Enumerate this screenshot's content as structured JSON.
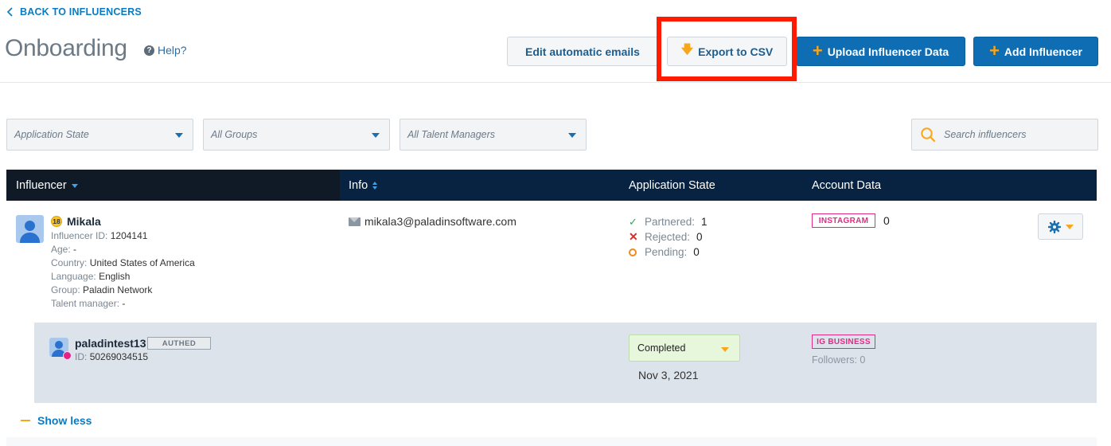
{
  "header": {
    "back_label": "BACK TO INFLUENCERS",
    "title": "Onboarding",
    "help_label": "Help?",
    "buttons": {
      "edit_emails": "Edit automatic emails",
      "export_csv": "Export to CSV",
      "upload_data": "Upload Influencer Data",
      "add_influencer": "Add Influencer"
    }
  },
  "filters": {
    "application_state": "Application State",
    "groups": "All Groups",
    "talent_managers": "All Talent Managers",
    "search_placeholder": "Search influencers"
  },
  "table": {
    "columns": [
      "Influencer",
      "Info",
      "Application State",
      "Account Data"
    ]
  },
  "row": {
    "age_badge": "18",
    "name": "Mikala",
    "details": [
      {
        "label": "Influencer ID:",
        "value": "1204141"
      },
      {
        "label": "Age:",
        "value": "-"
      },
      {
        "label": "Country:",
        "value": "United States of America"
      },
      {
        "label": "Language:",
        "value": "English"
      },
      {
        "label": "Group:",
        "value": "Paladin Network"
      },
      {
        "label": "Talent manager:",
        "value": "-"
      }
    ],
    "email": "mikala3@paladinsoftware.com",
    "states": [
      {
        "label": "Partnered:",
        "value": "1"
      },
      {
        "label": "Rejected:",
        "value": "0"
      },
      {
        "label": "Pending:",
        "value": "0"
      }
    ],
    "account_tag": "INSTAGRAM",
    "account_count": "0",
    "account": {
      "username": "paladintest13",
      "status_badge": "AUTHED",
      "id_label": "ID:",
      "id_value": "50269034515",
      "state_value": "Completed",
      "state_date": "Nov 3, 2021",
      "tag": "IG BUSINESS",
      "followers": "Followers: 0"
    }
  },
  "show_less_label": "Show less",
  "colors": {
    "accent": "#0e6db3",
    "highlight": "#ff1a00",
    "orange": "#f7a71b",
    "table_header": "#082341",
    "tag_pink": "#e02c84"
  }
}
